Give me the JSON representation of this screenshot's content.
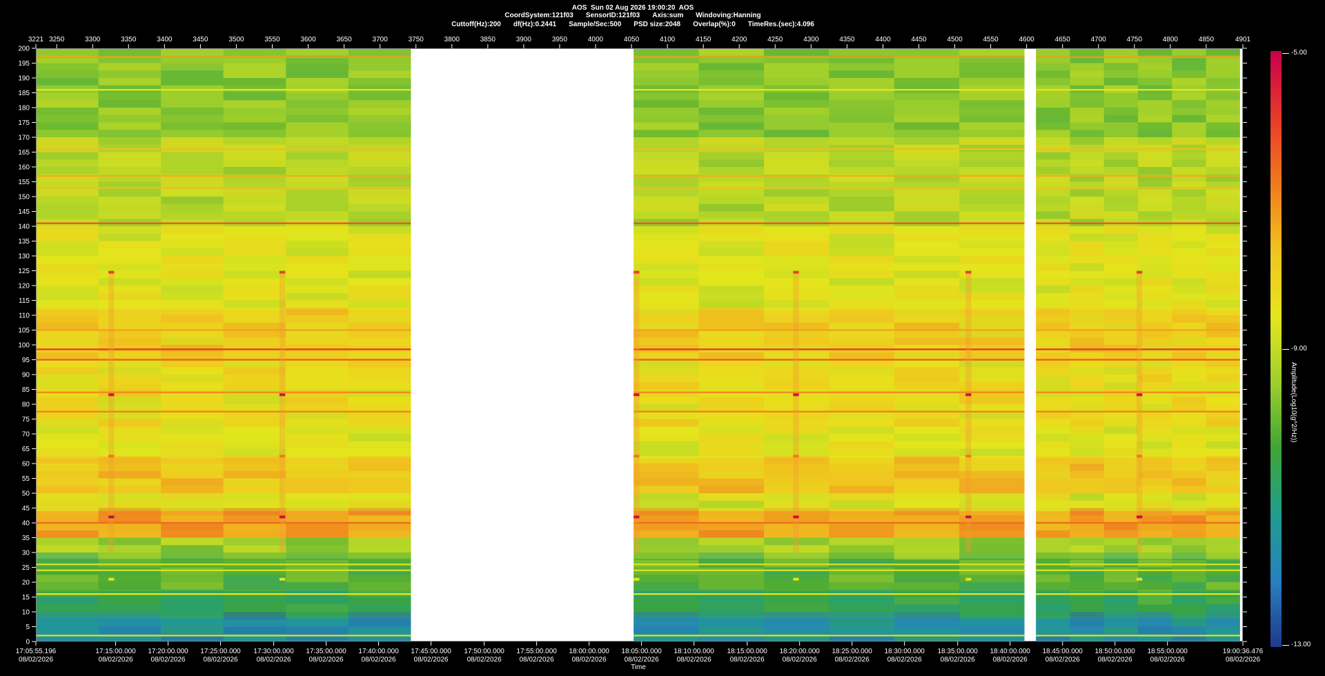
{
  "header": {
    "line1": "AOS  Sun 02 Aug 2026 19:00:20  AOS",
    "coord_system": "CoordSystem:121f03",
    "sensor_id": "SensorID:121f03",
    "axis": "Axis:sum",
    "windowing": "Windoving:Hanning",
    "cutoff": "Cuttoff(Hz):200",
    "df": "df(Hz):0.2441",
    "sample_rate": "Sample/Sec:500",
    "psd_size": "PSD size:2048",
    "overlap": "Overlap(%):0",
    "time_res": "TimeRes.(sec):4.096"
  },
  "colorbar": {
    "title": "Amplitude(Log10(g^2/Hz))",
    "labels": [
      "-5.00",
      "-9.00",
      "-13.00"
    ],
    "colors": [
      "#c8004b",
      "#e83a2a",
      "#f07a1e",
      "#f1c21f",
      "#e6e61c",
      "#9fcf2e",
      "#3fa535",
      "#1f9e8e",
      "#2a7fbf",
      "#1e3a8a"
    ]
  },
  "axes": {
    "xlabel": "Time"
  },
  "chart_data": {
    "type": "heatmap",
    "title": "AOS  Sun 02 Aug 2026 19:00:20  AOS",
    "xlabel": "Time",
    "ylabel": "",
    "ylim": [
      0,
      200
    ],
    "y_ticks": [
      0,
      5,
      10,
      15,
      20,
      25,
      30,
      35,
      40,
      45,
      50,
      55,
      60,
      65,
      70,
      75,
      80,
      85,
      90,
      95,
      100,
      105,
      110,
      115,
      120,
      125,
      130,
      135,
      140,
      145,
      150,
      155,
      160,
      165,
      170,
      175,
      180,
      185,
      190,
      195,
      200
    ],
    "top_xlim": [
      3221,
      4901
    ],
    "top_ticks": [
      3221,
      3250,
      3300,
      3350,
      3400,
      3450,
      3500,
      3550,
      3600,
      3650,
      3700,
      3750,
      3800,
      3850,
      3900,
      3950,
      4000,
      4050,
      4100,
      4150,
      4200,
      4250,
      4300,
      4350,
      4400,
      4450,
      4500,
      4550,
      4600,
      4650,
      4700,
      4750,
      4800,
      4850,
      4901
    ],
    "bottom_ticks": [
      {
        "x": 3221,
        "time": "17:05:55.196",
        "date": "08/02/2026"
      },
      {
        "x": 3332,
        "time": "17:15:00.000",
        "date": "08/02/2026"
      },
      {
        "x": 3405,
        "time": "17:20:00.000",
        "date": "08/02/2026"
      },
      {
        "x": 3478,
        "time": "17:25:00.000",
        "date": "08/02/2026"
      },
      {
        "x": 3552,
        "time": "17:30:00.000",
        "date": "08/02/2026"
      },
      {
        "x": 3625,
        "time": "17:35:00.000",
        "date": "08/02/2026"
      },
      {
        "x": 3698,
        "time": "17:40:00.000",
        "date": "08/02/2026"
      },
      {
        "x": 3771,
        "time": "17:45:00.000",
        "date": "08/02/2026"
      },
      {
        "x": 3845,
        "time": "17:50:00.000",
        "date": "08/02/2026"
      },
      {
        "x": 3918,
        "time": "17:55:00.000",
        "date": "08/02/2026"
      },
      {
        "x": 3991,
        "time": "18:00:00.000",
        "date": "08/02/2026"
      },
      {
        "x": 4064,
        "time": "18:05:00.000",
        "date": "08/02/2026"
      },
      {
        "x": 4137,
        "time": "18:10:00.000",
        "date": "08/02/2026"
      },
      {
        "x": 4211,
        "time": "18:15:00.000",
        "date": "08/02/2026"
      },
      {
        "x": 4284,
        "time": "18:20:00.000",
        "date": "08/02/2026"
      },
      {
        "x": 4357,
        "time": "18:25:00.000",
        "date": "08/02/2026"
      },
      {
        "x": 4430,
        "time": "18:30:00.000",
        "date": "08/02/2026"
      },
      {
        "x": 4504,
        "time": "18:35:00.000",
        "date": "08/02/2026"
      },
      {
        "x": 4577,
        "time": "18:40:00.000",
        "date": "08/02/2026"
      },
      {
        "x": 4650,
        "time": "18:45:00.000",
        "date": "08/02/2026"
      },
      {
        "x": 4723,
        "time": "18:50:00.000",
        "date": "08/02/2026"
      },
      {
        "x": 4796,
        "time": "18:55:00.000",
        "date": "08/02/2026"
      },
      {
        "x": 4901,
        "time": "19:00:36.476",
        "date": "08/02/2026"
      }
    ],
    "colorscale": {
      "min": -13.0,
      "max": -5.0,
      "label": "Amplitude(Log10(g^2/Hz))"
    },
    "data_segments": [
      [
        3221,
        3743
      ],
      [
        4053,
        4597
      ],
      [
        4613,
        4897
      ]
    ],
    "vertical_events_x": [
      3322,
      3560,
      4053,
      4275,
      4515,
      4753
    ],
    "bands": [
      {
        "y0": 0,
        "y1": 8,
        "level": -11.6
      },
      {
        "y0": 8,
        "y1": 17,
        "level": -10.6
      },
      {
        "y0": 17,
        "y1": 28,
        "level": -10.1
      },
      {
        "y0": 28,
        "y1": 35,
        "level": -9.4
      },
      {
        "y0": 35,
        "y1": 44,
        "level": -7.3
      },
      {
        "y0": 44,
        "y1": 50,
        "level": -8.7
      },
      {
        "y0": 50,
        "y1": 62,
        "level": -7.8
      },
      {
        "y0": 62,
        "y1": 72,
        "level": -8.6
      },
      {
        "y0": 72,
        "y1": 95,
        "level": -8.3
      },
      {
        "y0": 95,
        "y1": 112,
        "level": -8.0
      },
      {
        "y0": 112,
        "y1": 140,
        "level": -8.6
      },
      {
        "y0": 140,
        "y1": 170,
        "level": -9.1
      },
      {
        "y0": 170,
        "y1": 200,
        "level": -9.6
      }
    ],
    "lines": [
      {
        "y": 2,
        "level": -8.8
      },
      {
        "y": 16,
        "level": -8.6
      },
      {
        "y": 24,
        "level": -8.8
      },
      {
        "y": 26,
        "level": -8.8
      },
      {
        "y": 40,
        "level": -6.6
      },
      {
        "y": 77.5,
        "level": -6.9
      },
      {
        "y": 84,
        "level": -7.0
      },
      {
        "y": 95,
        "level": -6.4
      },
      {
        "y": 98.5,
        "level": -5.9
      },
      {
        "y": 105,
        "level": -7.3
      },
      {
        "y": 141,
        "level": -6.3
      },
      {
        "y": 153,
        "level": -7.6
      },
      {
        "y": 157,
        "level": -7.4
      },
      {
        "y": 166,
        "level": -7.6
      },
      {
        "y": 186,
        "level": -8.6
      },
      {
        "y": 197,
        "level": -7.2
      }
    ],
    "event_marks": [
      {
        "y": 124.5,
        "level": -6.0
      },
      {
        "y": 83.2,
        "level": -5.3
      },
      {
        "y": 62.5,
        "level": -6.8
      },
      {
        "y": 42,
        "level": -5.2
      },
      {
        "y": 21,
        "level": -8.6
      }
    ]
  }
}
